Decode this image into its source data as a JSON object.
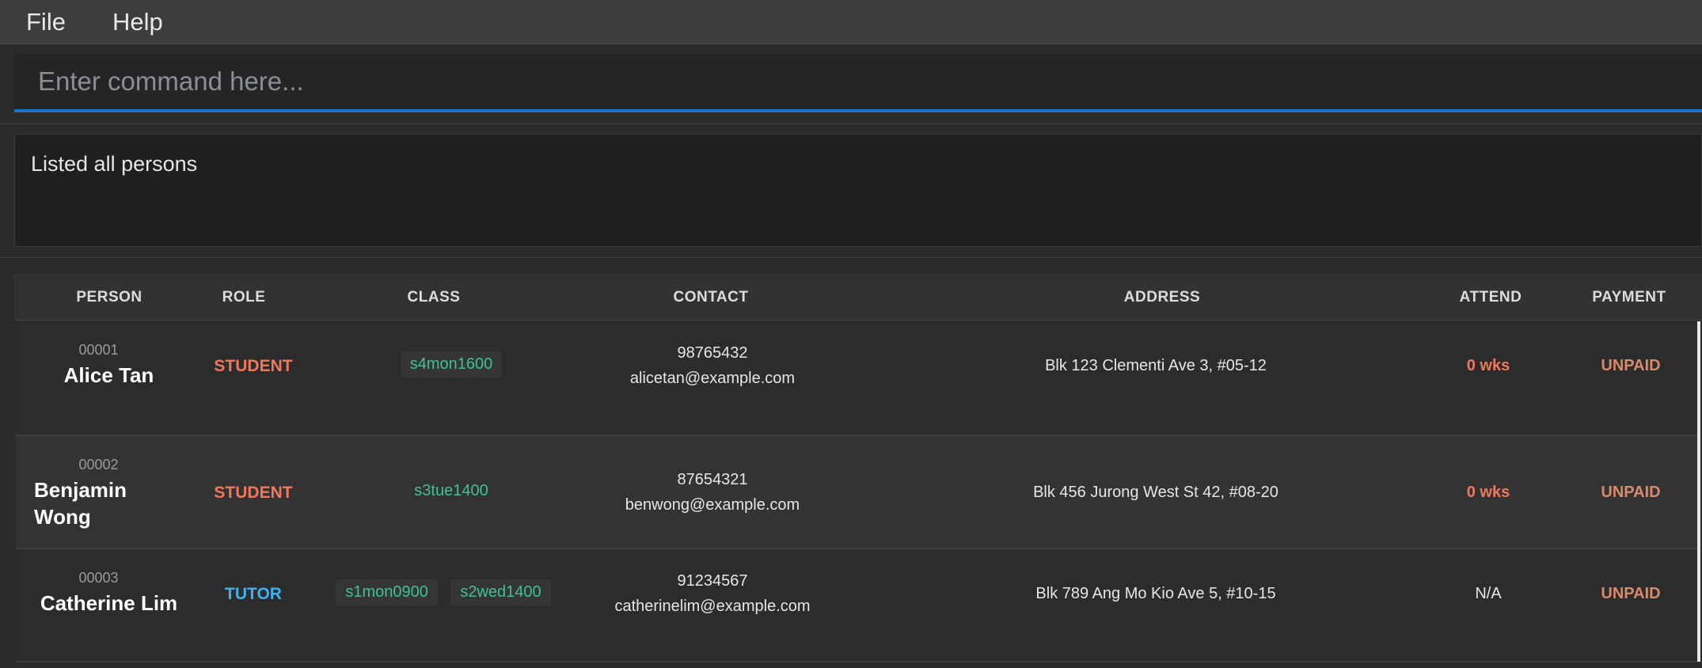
{
  "menu": {
    "items": [
      "File",
      "Help"
    ]
  },
  "command": {
    "placeholder": "Enter command here...",
    "value": ""
  },
  "result": {
    "message": "Listed all persons"
  },
  "table": {
    "headers": [
      "PERSON",
      "ROLE",
      "CLASS",
      "CONTACT",
      "ADDRESS",
      "ATTEND",
      "PAYMENT"
    ],
    "rows": [
      {
        "id": "00001",
        "name": "Alice Tan",
        "role": "STUDENT",
        "classes": [
          "s4mon1600"
        ],
        "phone": "98765432",
        "email": "alicetan@example.com",
        "address": "Blk 123 Clementi Ave 3, #05-12",
        "attend": "0 wks",
        "payment": "UNPAID"
      },
      {
        "id": "00002",
        "name": "Benjamin Wong",
        "name_line1": "Benjamin",
        "name_line2": "Wong",
        "role": "STUDENT",
        "classes": [
          "s3tue1400"
        ],
        "phone": "87654321",
        "email": "benwong@example.com",
        "address": "Blk 456 Jurong West St 42, #08-20",
        "attend": "0 wks",
        "payment": "UNPAID"
      },
      {
        "id": "00003",
        "name": "Catherine Lim",
        "role": "TUTOR",
        "classes": [
          "s1mon0900",
          "s2wed1400"
        ],
        "phone": "91234567",
        "email": "catherinelim@example.com",
        "address": "Blk 789 Ang Mo Kio Ave 5, #10-15",
        "attend": "N/A",
        "payment": "UNPAID"
      }
    ]
  },
  "colors": {
    "accent": "#1a73c7",
    "student_role": "#f0785a",
    "tutor_role": "#3fb0f0",
    "class_chip_text": "#3fbf9a",
    "attend_warning": "#f0785a",
    "payment_unpaid": "#d98a6a"
  }
}
